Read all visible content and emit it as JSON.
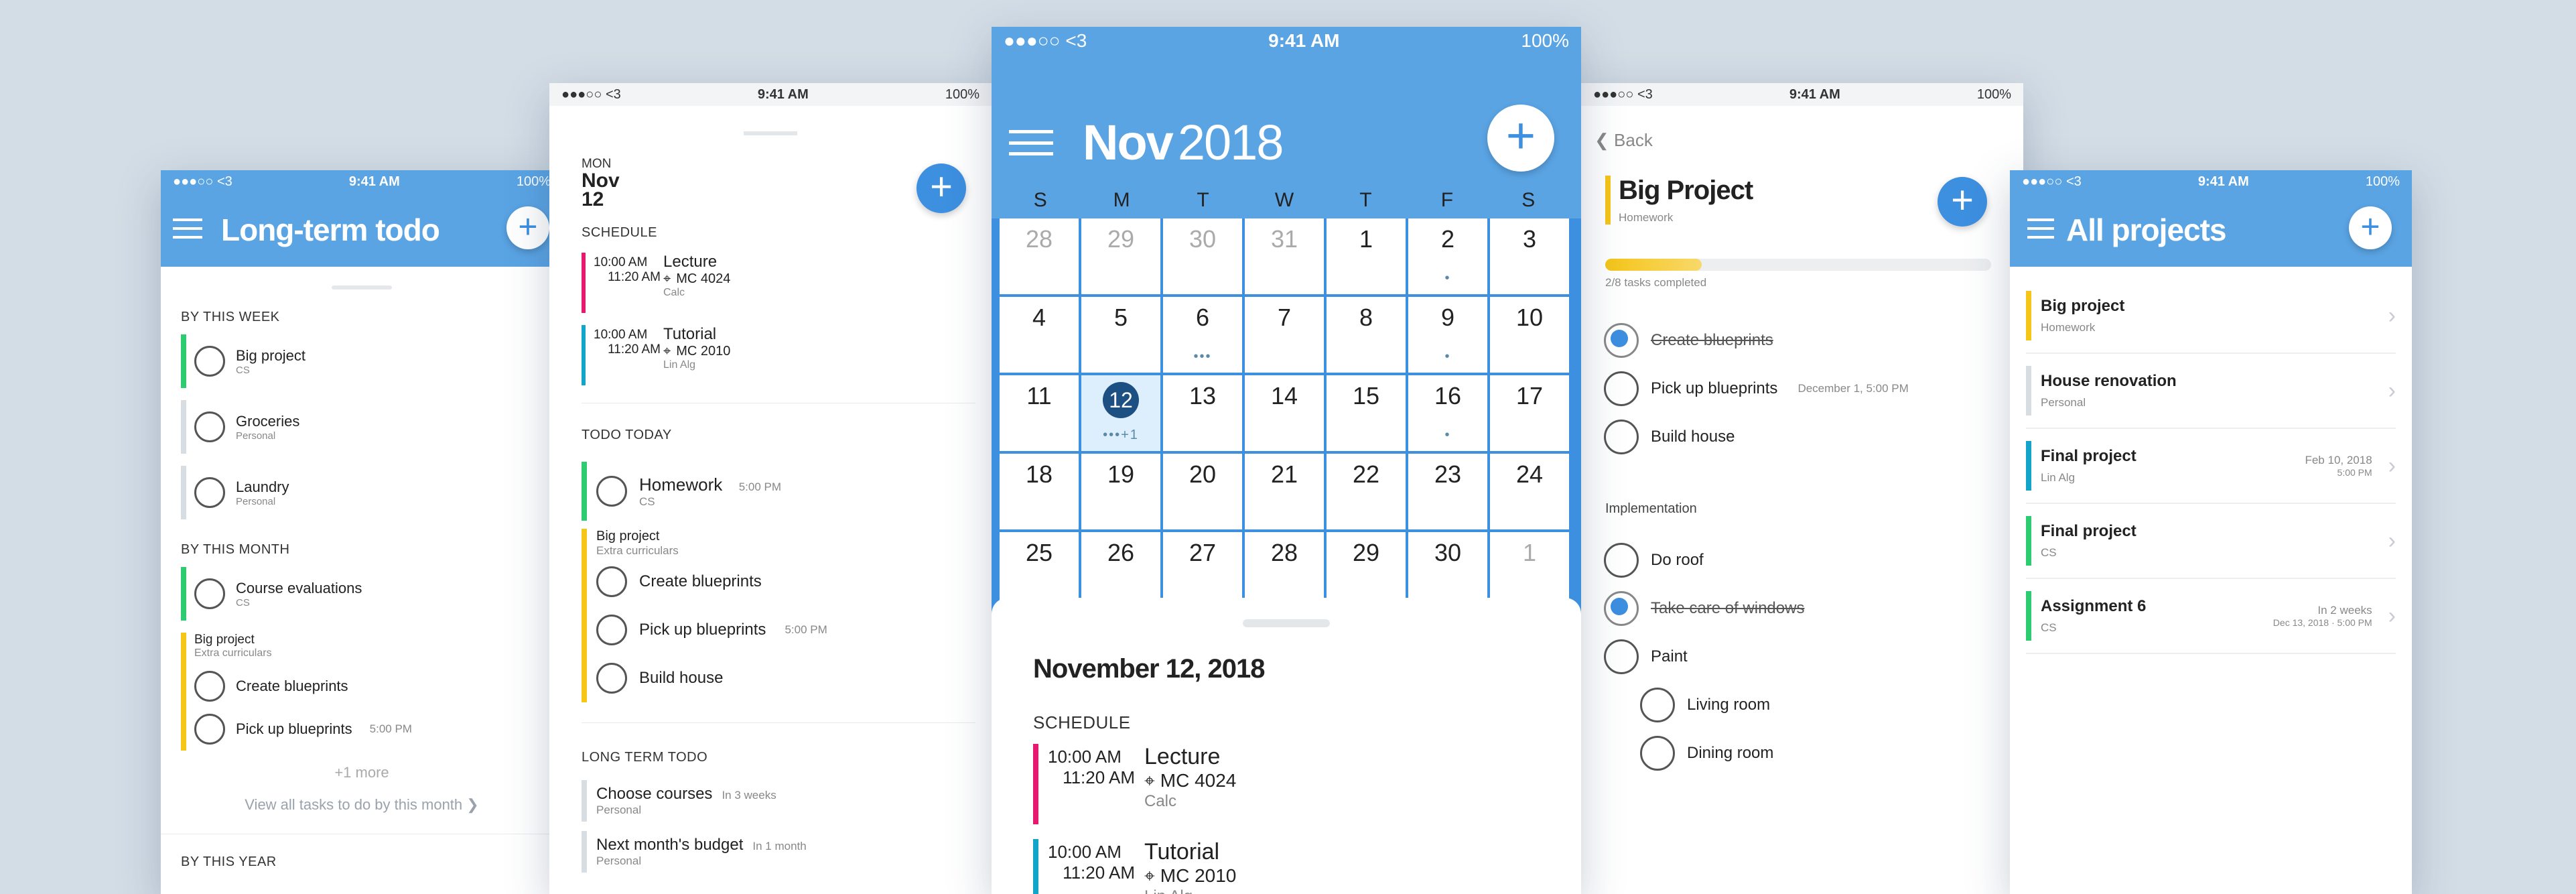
{
  "status": {
    "carrier": "●●●○○ <3",
    "time": "9:41 AM",
    "battery": "100%"
  },
  "screen1": {
    "title": "Long-term todo",
    "sections": [
      {
        "label": "BY THIS WEEK",
        "items": [
          {
            "name": "Big project",
            "sub": "CS",
            "color": "#2ecc71"
          },
          {
            "name": "Groceries",
            "sub": "Personal",
            "color": "#d8dde2"
          },
          {
            "name": "Laundry",
            "sub": "Personal",
            "color": "#d8dde2"
          }
        ]
      },
      {
        "label": "BY THIS MONTH",
        "items": [
          {
            "name": "Course evaluations",
            "sub": "CS",
            "color": "#2ecc71"
          }
        ]
      }
    ],
    "group": {
      "title": "Big project",
      "sub": "Extra curriculars",
      "items": [
        {
          "name": "Create blueprints",
          "time": ""
        },
        {
          "name": "Pick up blueprints",
          "time": "5:00 PM"
        }
      ]
    },
    "more": "+1 more",
    "view_all": "View all tasks to do by this month ❯",
    "year": "BY THIS YEAR"
  },
  "screen2": {
    "day_label": "MON",
    "day_month": "Nov",
    "day_num": "12",
    "schedule": "SCHEDULE",
    "events": [
      {
        "start": "10:00 AM",
        "end": "11:20 AM",
        "name": "Lecture",
        "loc": "MC 4024",
        "sub": "Calc",
        "color": "#e6196e"
      },
      {
        "start": "10:00 AM",
        "end": "11:20 AM",
        "name": "Tutorial",
        "loc": "MC 2010",
        "sub": "Lin Alg",
        "color": "#12a5c9"
      }
    ],
    "todo_today": "TODO TODAY",
    "homework": {
      "name": "Homework",
      "time": "5:00 PM",
      "sub": "CS"
    },
    "group": {
      "title": "Big project",
      "sub": "Extra curriculars",
      "items": [
        {
          "name": "Create blueprints",
          "time": ""
        },
        {
          "name": "Pick up blueprints",
          "time": "5:00 PM"
        },
        {
          "name": "Build house",
          "time": ""
        }
      ]
    },
    "long_term": "LONG TERM TODO",
    "lt_items": [
      {
        "name": "Choose courses",
        "time": "In 3 weeks",
        "sub": "Personal"
      },
      {
        "name": "Next month's budget",
        "time": "In 1 month",
        "sub": "Personal"
      }
    ]
  },
  "screen3": {
    "month": "Nov",
    "year": "2018",
    "weekdays": [
      "S",
      "M",
      "T",
      "W",
      "T",
      "F",
      "S"
    ],
    "days": [
      {
        "d": "28",
        "out": true,
        "dots": ""
      },
      {
        "d": "29",
        "out": true,
        "dots": ""
      },
      {
        "d": "30",
        "out": true,
        "dots": ""
      },
      {
        "d": "31",
        "out": true,
        "dots": ""
      },
      {
        "d": "1",
        "out": false,
        "dots": ""
      },
      {
        "d": "2",
        "out": false,
        "dots": "•"
      },
      {
        "d": "3",
        "out": false,
        "dots": ""
      },
      {
        "d": "4",
        "out": false,
        "dots": ""
      },
      {
        "d": "5",
        "out": false,
        "dots": ""
      },
      {
        "d": "6",
        "out": false,
        "dots": "•••"
      },
      {
        "d": "7",
        "out": false,
        "dots": ""
      },
      {
        "d": "8",
        "out": false,
        "dots": ""
      },
      {
        "d": "9",
        "out": false,
        "dots": "•"
      },
      {
        "d": "10",
        "out": false,
        "dots": ""
      },
      {
        "d": "11",
        "out": false,
        "dots": ""
      },
      {
        "d": "12",
        "out": false,
        "dots": "•••+1",
        "sel": true
      },
      {
        "d": "13",
        "out": false,
        "dots": ""
      },
      {
        "d": "14",
        "out": false,
        "dots": ""
      },
      {
        "d": "15",
        "out": false,
        "dots": ""
      },
      {
        "d": "16",
        "out": false,
        "dots": "•"
      },
      {
        "d": "17",
        "out": false,
        "dots": ""
      },
      {
        "d": "18",
        "out": false,
        "dots": ""
      },
      {
        "d": "19",
        "out": false,
        "dots": ""
      },
      {
        "d": "20",
        "out": false,
        "dots": ""
      },
      {
        "d": "21",
        "out": false,
        "dots": ""
      },
      {
        "d": "22",
        "out": false,
        "dots": ""
      },
      {
        "d": "23",
        "out": false,
        "dots": ""
      },
      {
        "d": "24",
        "out": false,
        "dots": ""
      },
      {
        "d": "25",
        "out": false,
        "dots": ""
      },
      {
        "d": "26",
        "out": false,
        "dots": ""
      },
      {
        "d": "27",
        "out": false,
        "dots": ""
      },
      {
        "d": "28",
        "out": false,
        "dots": ""
      },
      {
        "d": "29",
        "out": false,
        "dots": ""
      },
      {
        "d": "30",
        "out": false,
        "dots": ""
      },
      {
        "d": "1",
        "out": true,
        "dots": ""
      }
    ],
    "sheet_title": "November 12, 2018",
    "schedule": "SCHEDULE",
    "events": [
      {
        "start": "10:00 AM",
        "end": "11:20 AM",
        "name": "Lecture",
        "loc": "MC 4024",
        "sub": "Calc",
        "color": "#e6196e"
      },
      {
        "start": "10:00 AM",
        "end": "11:20 AM",
        "name": "Tutorial",
        "loc": "MC 2010",
        "sub": "Lin Alg",
        "color": "#12a5c9"
      }
    ]
  },
  "screen4": {
    "back": "Back",
    "title": "Big Project",
    "sub": "Homework",
    "progress": 0.25,
    "progress_text": "2/8 tasks completed",
    "tasks": [
      {
        "name": "Create blueprints",
        "done": true,
        "time": ""
      },
      {
        "name": "Pick up blueprints",
        "done": false,
        "time": "December 1, 5:00 PM"
      },
      {
        "name": "Build house",
        "done": false,
        "time": ""
      }
    ],
    "impl_label": "Implementation",
    "impl": [
      {
        "name": "Do roof",
        "done": false
      },
      {
        "name": "Take care of windows",
        "done": true
      },
      {
        "name": "Paint",
        "done": false
      }
    ],
    "sub_tasks": [
      "Living room",
      "Dining room"
    ]
  },
  "screen5": {
    "title": "All projects",
    "projects": [
      {
        "name": "Big project",
        "sub": "Homework",
        "date": "",
        "time": "",
        "color": "#f5c518"
      },
      {
        "name": "House renovation",
        "sub": "Personal",
        "date": "",
        "time": "",
        "color": "#d8dde2"
      },
      {
        "name": "Final project",
        "sub": "Lin Alg",
        "date": "Feb 10, 2018",
        "time": "5:00 PM",
        "color": "#12a5c9"
      },
      {
        "name": "Final project",
        "sub": "CS",
        "date": "",
        "time": "",
        "color": "#2ecc71"
      },
      {
        "name": "Assignment 6",
        "sub": "CS",
        "date": "In 2 weeks",
        "time": "Dec 13, 2018 · 5:00 PM",
        "color": "#2ecc71"
      }
    ]
  }
}
